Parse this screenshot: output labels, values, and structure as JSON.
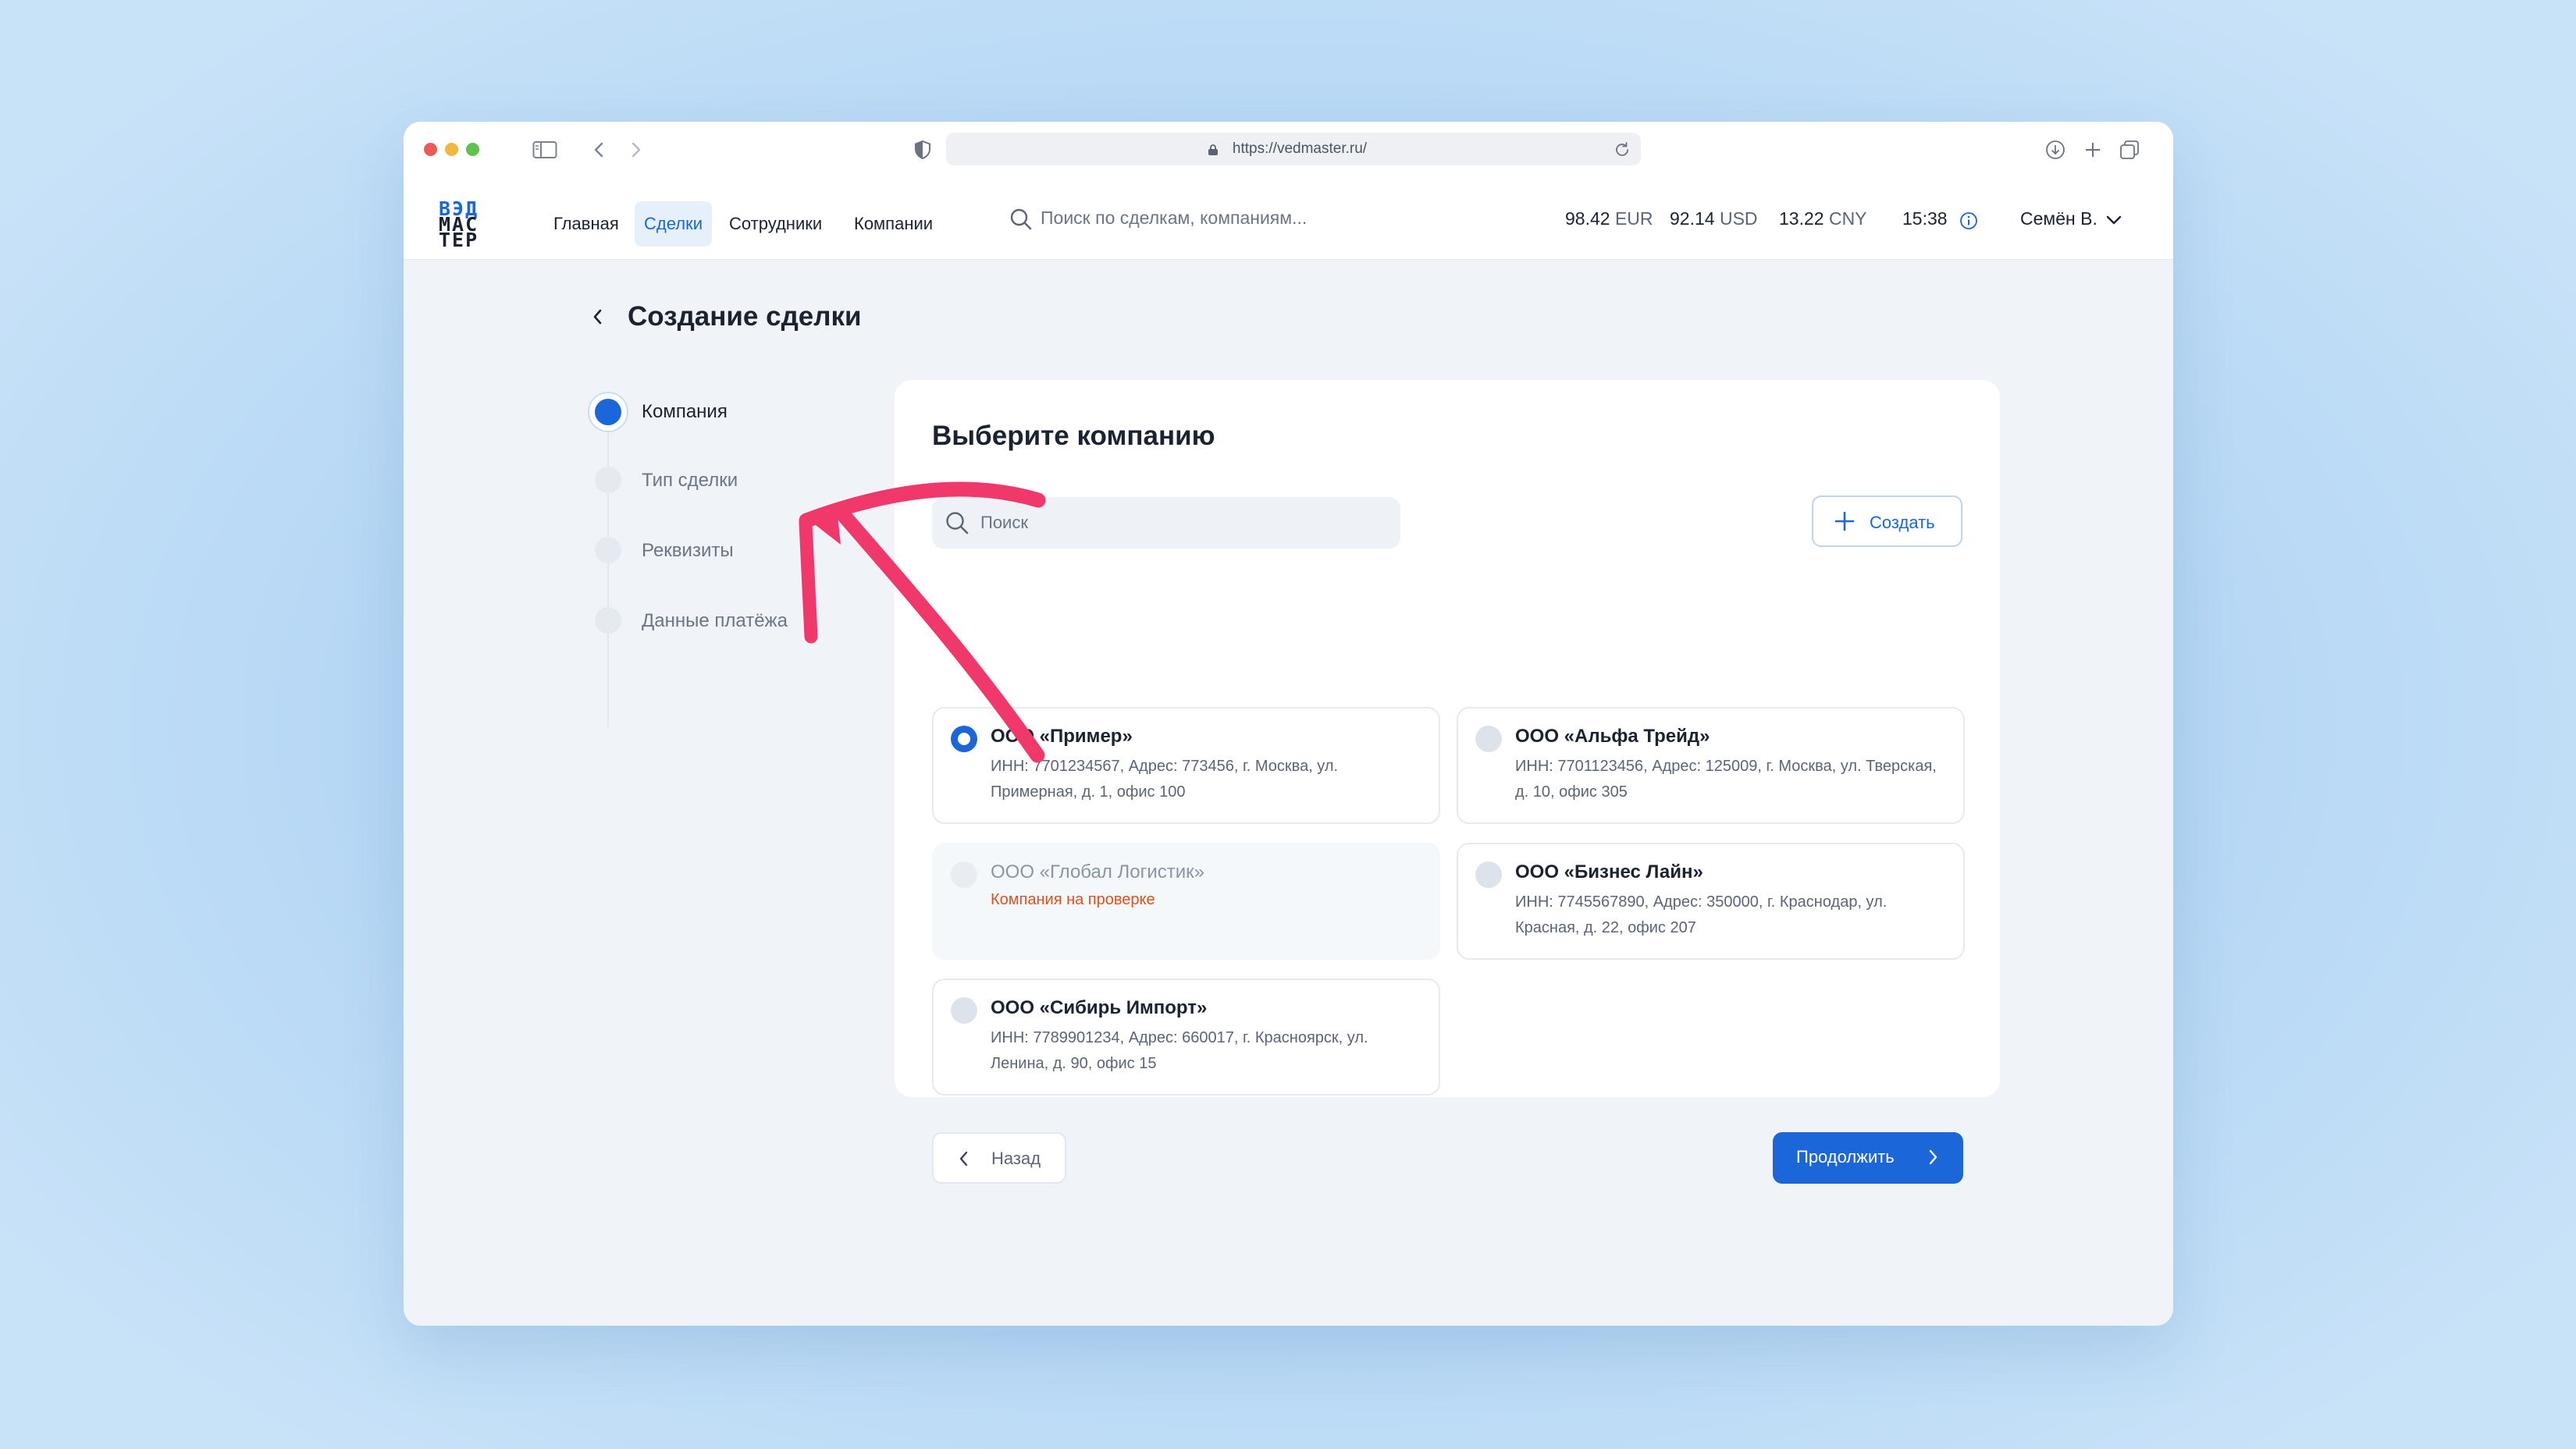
{
  "browser": {
    "url": "https://vedmaster.ru/"
  },
  "header": {
    "logo_lines": [
      "ВЭД",
      "МАС",
      "ТЕР"
    ],
    "nav": [
      {
        "label": "Главная",
        "active": false
      },
      {
        "label": "Сделки",
        "active": true
      },
      {
        "label": "Сотрудники",
        "active": false
      },
      {
        "label": "Компании",
        "active": false
      }
    ],
    "search_placeholder": "Поиск по сделкам, компаниям...",
    "rates": [
      {
        "value": "98.42",
        "currency": "EUR"
      },
      {
        "value": "92.14",
        "currency": "USD"
      },
      {
        "value": "13.22",
        "currency": "CNY"
      }
    ],
    "time": "15:38",
    "user": "Семён В."
  },
  "page": {
    "title": "Создание сделки"
  },
  "steps": [
    {
      "label": "Компания",
      "active": true
    },
    {
      "label": "Тип сделки",
      "active": false
    },
    {
      "label": "Реквизиты",
      "active": false
    },
    {
      "label": "Данные платёжа",
      "active": false
    }
  ],
  "card": {
    "title": "Выберите компанию",
    "search_placeholder": "Поиск",
    "create_label": "Создать",
    "companies": [
      {
        "name": "ООО «Пример»",
        "details": "ИНН: 7701234567, Адрес: 773456, г. Москва, ул. Примерная, д. 1, офис 100",
        "status": "selected"
      },
      {
        "name": "ООО «Альфа Трейд»",
        "details": "ИНН: 7701123456, Адрес: 125009, г. Москва, ул. Тверская, д. 10, офис 305",
        "status": "default"
      },
      {
        "name": "ООО «Глобал Логистик»",
        "details": "",
        "warning": "Компания на проверке",
        "status": "disabled"
      },
      {
        "name": "ООО «Бизнес Лайн»",
        "details": "ИНН: 7745567890, Адрес: 350000, г. Краснодар, ул. Красная, д. 22, офис 207",
        "status": "default"
      },
      {
        "name": "ООО «Сибирь Импорт»",
        "details": "ИНН: 7789901234, Адрес: 660017, г. Красноярск, ул. Ленина, д. 90, офис 15",
        "status": "default"
      }
    ],
    "back_label": "Назад",
    "next_label": "Продолжить"
  },
  "colors": {
    "accent": "#1b66d9",
    "warning": "#e0501d",
    "annotation_arrow": "#f0386b"
  }
}
